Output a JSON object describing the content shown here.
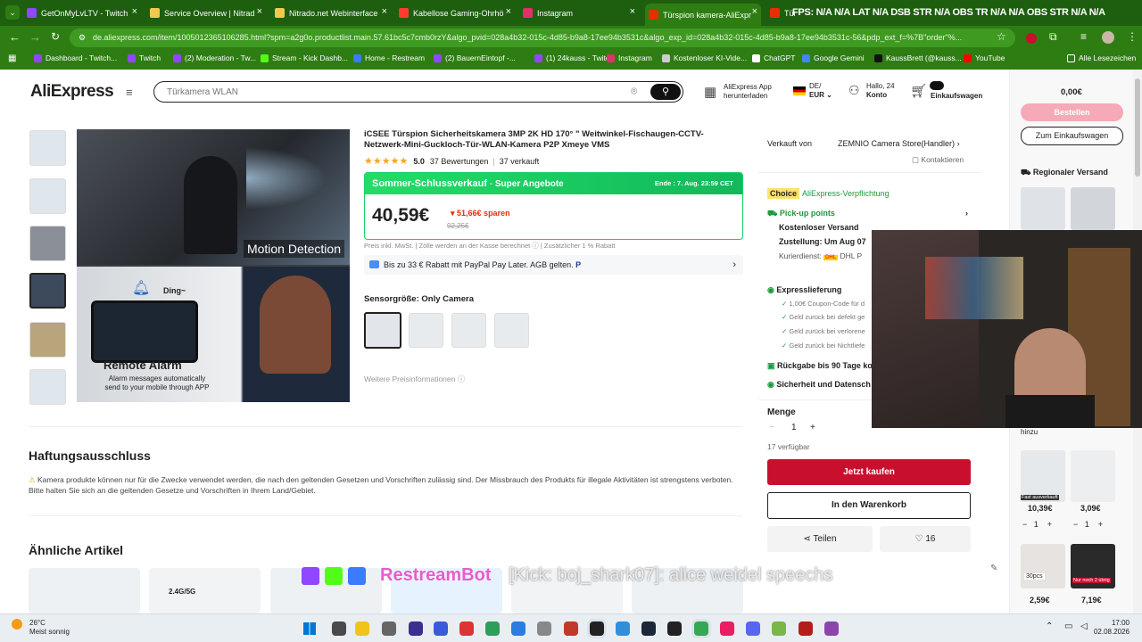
{
  "tabs": [
    {
      "label": "GetOnMyLvLTV - Twitch",
      "color": "#9146ff"
    },
    {
      "label": "Service Overview | Nitrad",
      "color": "#f2c94c"
    },
    {
      "label": "Nitrado.net Webinterface",
      "color": "#f2c94c"
    },
    {
      "label": "Kabellose Gaming-Ohrhö",
      "color": "#ff3b30"
    },
    {
      "label": "Instagram",
      "color": "#e1306c"
    },
    {
      "label": "Türspion kamera-AliExpr",
      "color": "#e62e04"
    },
    {
      "label": "Tür",
      "color": "#e62e04"
    }
  ],
  "tab_overlay": "FPS: N/A  N/A  LAT N/A  DSB STR N/A  OBS TR  N/A N/A  OBS STR  N/A  N/A",
  "url": "de.aliexpress.com/item/1005012365106285.html?spm=a2g0o.productlist.main.57.61bc5c7cmb0rzY&algo_pvid=028a4b32-015c-4d85-b9a8-17ee94b3531c&algo_exp_id=028a4b32-015c-4d85-b9a8-17ee94b3531c-56&pdp_ext_f=%7B\"order\"%...",
  "bookmarks": [
    {
      "label": "Dashboard - Twitch...",
      "color": "#9146ff"
    },
    {
      "label": "Twitch",
      "color": "#9146ff"
    },
    {
      "label": "(2) Moderation - Tw...",
      "color": "#9146ff"
    },
    {
      "label": "Stream - Kick Dashb...",
      "color": "#53fc18"
    },
    {
      "label": "Home - Restream",
      "color": "#3a7bff"
    },
    {
      "label": "(2) BauernEintopf -...",
      "color": "#9146ff"
    },
    {
      "label": "(1) 24kauss - Twitch",
      "color": "#9146ff"
    },
    {
      "label": "Instagram",
      "color": "#e1306c"
    },
    {
      "label": "Kostenloser KI-Vide...",
      "color": "#cccccc"
    },
    {
      "label": "ChatGPT",
      "color": "#ffffff"
    },
    {
      "label": "Google Gemini",
      "color": "#4285f4"
    },
    {
      "label": "KaussBrett (@kauss...",
      "color": "#111111"
    },
    {
      "label": "YouTube",
      "color": "#ff0000"
    }
  ],
  "bookmarks_all": "Alle Lesezeichen",
  "header": {
    "logo": "AliExpress",
    "search_placeholder": "Türkamera WLAN",
    "app_line1": "AliExpress App",
    "app_line2": "herunterladen",
    "region_line1": "DE/",
    "region_line2": "EUR",
    "account_line1": "Hallo, 24",
    "account_line2": "Konto",
    "cart_label": "Einkaufswagen",
    "cart_count": "0"
  },
  "product": {
    "title": "iCSEE Türspion Sicherheitskamera 3MP 2K HD 170° \" Weitwinkel-Fischaugen-CCTV-Netzwerk-Mini-Guckloch-Tür-WLAN-Kamera P2P Xmeye VMS",
    "rating": "5.0",
    "reviews": "37 Bewertungen",
    "sold": "37 verkauft",
    "sale_title": "Sommer-Schlussverkauf",
    "sale_sub": "Super Angebote",
    "sale_end": "Ende : 7. Aug. 23:59 CET",
    "price": "40,59€",
    "save": "51,66€ sparen",
    "old_price": "92,25€",
    "tax_note": "Preis inkl. MwSt. | Zölle werden an der Kasse berechnet ⓘ | Zusätzlicher 1 % Rabatt",
    "paypal": "Bis zu 33 € Rabatt mit PayPal Pay Later. AGB gelten.",
    "sensor_label": "Sensorgröße: Only Camera",
    "more_info": "Weitere Preisinformationen",
    "img1_caption": "Motion Detection",
    "img2_ding": "Ding~",
    "img2_title": "Remote Alarm",
    "img2_sub1": "Alarm messages automatically",
    "img2_sub2": "send to your mobile through APP"
  },
  "disclaimer": {
    "heading": "Haftungsausschluss",
    "text": "Kamera produkte können nur für die Zwecke verwendet werden, die nach den geltenden Gesetzen und Vorschriften zulässig sind. Der Missbrauch des Produkts für illegale Aktivitäten ist strengstens verboten. Bitte halten Sie sich an die geltenden Gesetze und Vorschriften in Ihrem Land/Gebiet."
  },
  "similar": {
    "heading": "Ähnliche Artikel",
    "c2_tag": "2.4G/5G"
  },
  "seller": {
    "label": "Verkauft von",
    "store": "ZEMNIO Camera Store(Handler)",
    "contact": "Kontaktieren",
    "choice": "Choice",
    "commitment": "AliExpress-Verpflichtung",
    "pickup": "Pick-up points",
    "free_ship": "Kostenloser Versand",
    "delivery": "Zustellung: Um Aug 07",
    "courier": "Kurierdienst:",
    "courier_name": "DHL P",
    "express": "Expresslieferung",
    "coupon": "1,00€ Coupon-Code für d",
    "refund1": "Geld zurück bei defekt ge",
    "refund2": "Geld zurück bei verlorene",
    "refund3": "Geld zurück bei Nichtliefe",
    "returns": "Rückgabe bis 90 Tage ko",
    "security": "Sicherheit und Datensch",
    "qty_label": "Menge",
    "qty": "1",
    "available": "17 verfügbar",
    "buy": "Jetzt kaufen",
    "add_cart": "In den Warenkorb",
    "share": "Teilen",
    "likes": "16"
  },
  "cart": {
    "total": "0,00€",
    "order": "Bestellen",
    "to_cart": "Zum Einkaufswagen",
    "regional": "Regionaler Versand",
    "add_hint": "hinzu",
    "items": [
      {
        "price": "10,39€",
        "qty": "1",
        "badge": "Fast ausverkauft"
      },
      {
        "price": "3,09€",
        "qty": "1",
        "badge": ""
      },
      {
        "price": "2,59€",
        "qty": "",
        "badge": "30pcs"
      },
      {
        "price": "7,19€",
        "qty": "",
        "badge": "Nur noch 2 übrig"
      }
    ]
  },
  "chat_overlay": "[Kick: boj_shark07]: alice weidel speechs",
  "chat_bot": "RestreamBot",
  "taskbar": {
    "temp": "26°C",
    "weather": "Meist sonnig",
    "time": "17:00",
    "date": "02.08.2026"
  }
}
